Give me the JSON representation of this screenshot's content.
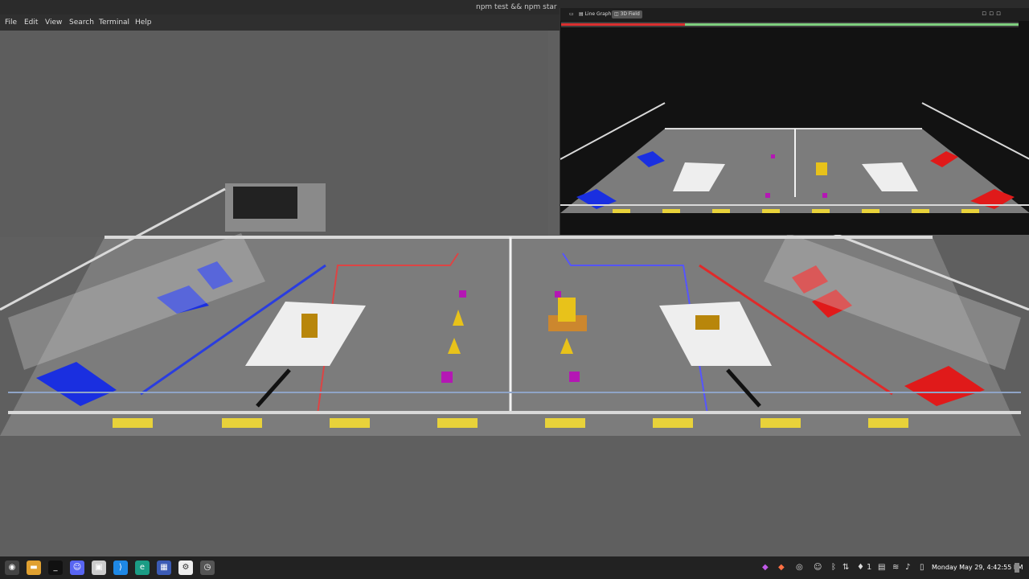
{
  "window": {
    "title": "npm test && npm star"
  },
  "menu": [
    "File",
    "Edit",
    "View",
    "Search",
    "Terminal",
    "Help"
  ],
  "sim": {
    "tabs": [
      {
        "label": "Line Graph",
        "icon": "graph-icon"
      },
      {
        "label": "3D Field",
        "icon": "field-icon"
      }
    ],
    "health": {
      "red_fraction": 0.27,
      "green_fraction": 0.73
    }
  },
  "taskbar": {
    "apps": [
      "menu-icon",
      "files-icon",
      "terminal-icon",
      "discord-icon",
      "image-viewer-icon",
      "vscode-icon",
      "edge-icon",
      "calculator-icon",
      "settings-icon",
      "timer-icon"
    ],
    "workspace": "1",
    "clock": "Monday May 29, 4:42:55 PM"
  },
  "colors": {
    "blue_alliance": "#1a2fe0",
    "red_alliance": "#e01a1a",
    "game_piece_cone": "#e8c21a",
    "game_piece_cube": "#b417b4"
  }
}
